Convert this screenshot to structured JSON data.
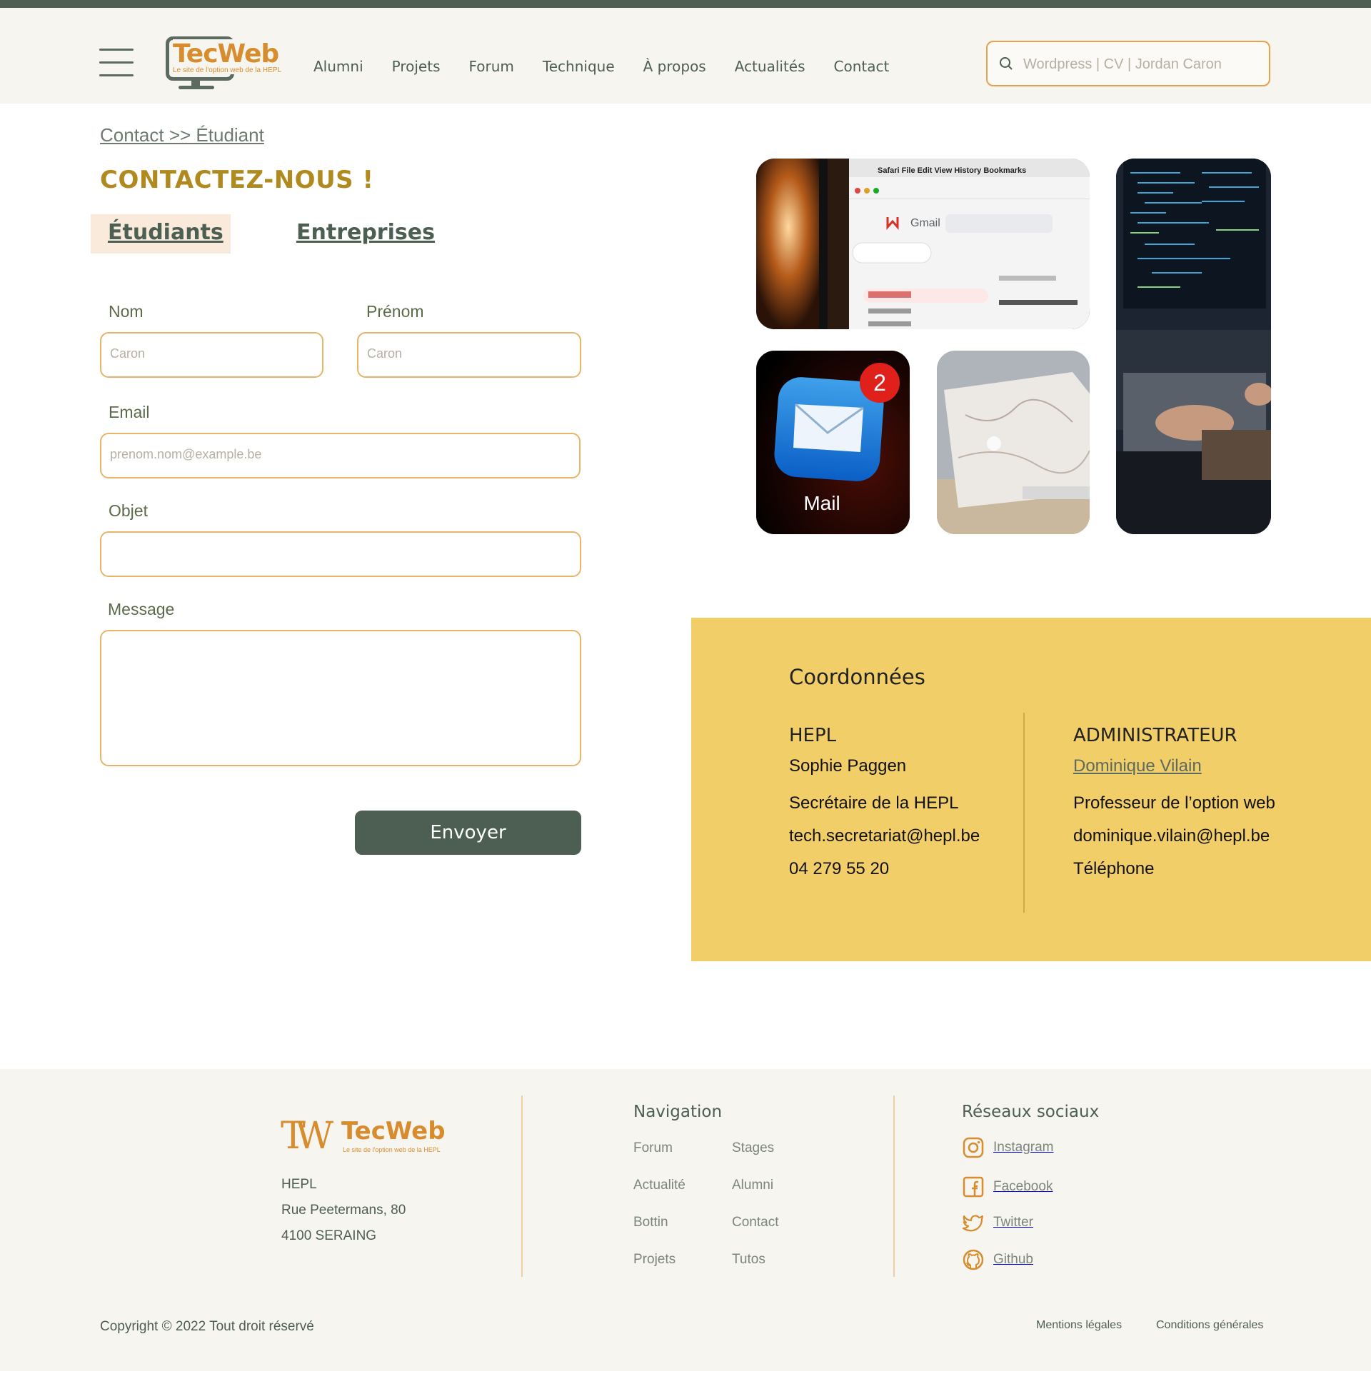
{
  "header": {
    "logo": {
      "title": "TecWeb",
      "subtitle": "Le site de l'option web de la HEPL"
    },
    "nav": [
      "Alumni",
      "Projets",
      "Forum",
      "Technique",
      "À propos",
      "Actualités",
      "Contact"
    ],
    "search_placeholder": "Wordpress  |  CV  |  Jordan Caron"
  },
  "breadcrumb": "Contact >> Étudiant",
  "page_title": "CONTACTEZ-NOUS !",
  "tabs": {
    "students": "Étudiants",
    "companies": "Entreprises"
  },
  "form": {
    "nom_label": "Nom",
    "nom_placeholder": "Caron",
    "prenom_label": "Prénom",
    "prenom_placeholder": "Caron",
    "email_label": "Email",
    "email_placeholder": "prenom.nom@example.be",
    "objet_label": "Objet",
    "message_label": "Message",
    "submit": "Envoyer"
  },
  "images": {
    "gmail_text": "Gmail",
    "mail_text": "Mail",
    "mail_badge": "2"
  },
  "coordonnees": {
    "title": "Coordonnées",
    "hepl": {
      "heading": "HEPL",
      "name": "Sophie Paggen",
      "role": "Secrétaire de la HEPL",
      "email": "tech.secretariat@hepl.be",
      "phone": "04 279 55 20"
    },
    "admin": {
      "heading": "ADMINISTRATEUR",
      "name": "Dominique Vilain",
      "role": "Professeur de l’option web",
      "email": "dominique.vilain@hepl.be",
      "phone": "Téléphone"
    }
  },
  "footer": {
    "logo": {
      "title": "TecWeb",
      "subtitle": "Le site de l'option web de la HEPL"
    },
    "address": [
      "HEPL",
      "Rue Peetermans, 80",
      "4100 SERAING"
    ],
    "nav_title": "Navigation",
    "nav_col1": [
      "Forum",
      "Actualité",
      "Bottin",
      "Projets"
    ],
    "nav_col2": [
      "Stages",
      "Alumni",
      "Contact",
      "Tutos"
    ],
    "social_title": "Réseaux sociaux",
    "social": [
      "Instagram",
      "Facebook",
      "Twitter",
      "Github"
    ],
    "copyright": "Copyright © 2022 Tout droit réservé",
    "legal": "Mentions légales",
    "terms": "Conditions générales"
  },
  "colors": {
    "accent": "#d78c2d",
    "dark": "#4d5e52",
    "yellow": "#f1ce68",
    "gold": "#b08a1f"
  }
}
